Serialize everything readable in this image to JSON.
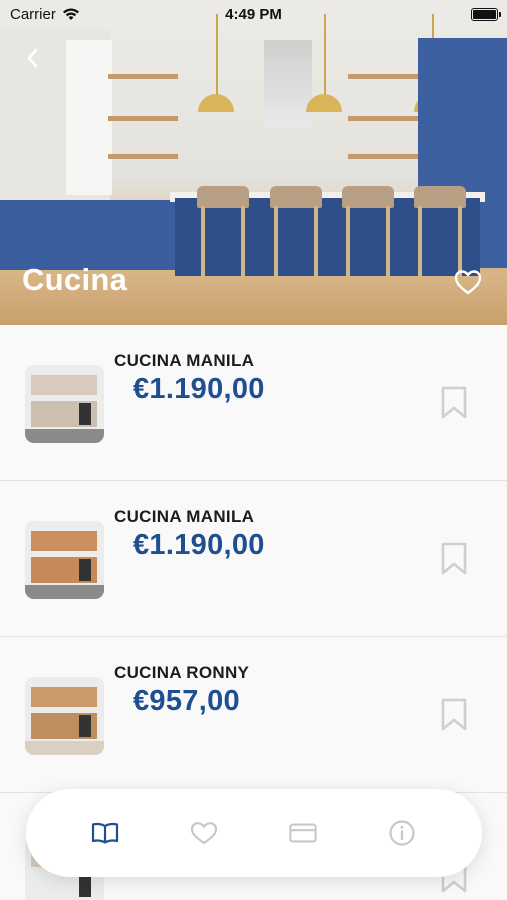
{
  "status_bar": {
    "carrier": "Carrier",
    "time": "4:49 PM"
  },
  "hero": {
    "title": "Cucina"
  },
  "products": [
    {
      "name": "CUCINA MANILA",
      "price": "€1.190,00"
    },
    {
      "name": "CUCINA MANILA",
      "price": "€1.190,00"
    },
    {
      "name": "CUCINA RONNY",
      "price": "€957,00"
    }
  ],
  "tabs": [
    {
      "icon": "book-icon",
      "active": true
    },
    {
      "icon": "heart-icon",
      "active": false
    },
    {
      "icon": "card-icon",
      "active": false
    },
    {
      "icon": "info-icon",
      "active": false
    }
  ],
  "colors": {
    "accent": "#1f4f91",
    "inactive_icon": "#c8c8c8",
    "bookmark": "#cfcfcf"
  }
}
